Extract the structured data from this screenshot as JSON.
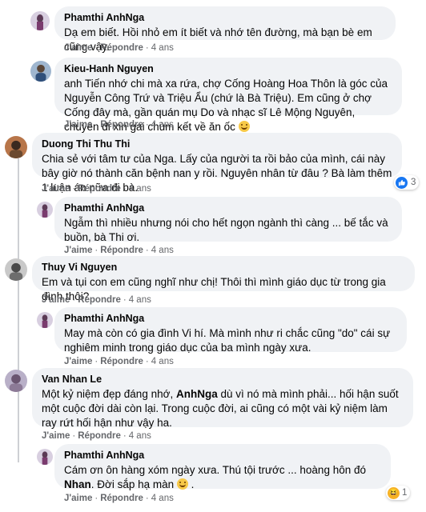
{
  "actions": {
    "like": "J'aime",
    "reply": "Répondre",
    "separator": "·"
  },
  "comments": [
    {
      "author": "Phamthi AnhNga",
      "text_parts": [
        {
          "t": "Dạ em biết. Hồi nhỏ em ít biết và nhớ tên đường, mà bạn bè em cũng vậy.",
          "b": false
        }
      ],
      "time": "4 ans"
    },
    {
      "author": "Kieu-Hanh Nguyen",
      "text_parts": [
        {
          "t": "anh Tiến nhớ chi mà xa rứa, chợ Cống Hoàng Hoa Thôn là góc của Nguyễn Công Trứ và Triệu Ẩu (chứ là Bà Triệu). Em cũng ở chợ Cống đây mà, gần quán mụ Do và nhạc sĩ Lê Mộng Nguyên, chuyên đi xin gai chùm kết về ăn ốc",
          "b": false
        }
      ],
      "time": "4 ans",
      "emoji": "grin-emoji"
    },
    {
      "author": "Duong Thi Thu Thi",
      "text_parts": [
        {
          "t": "Chia sẻ với tâm tư của Nga. Lấy của người ta rồi bảo của mình, cái này bây giờ nó thành căn bệnh nan y rồi. Nguyên nhân từ đâu ? Bà làm thêm 1 luận án nữa đi bà.",
          "b": false
        }
      ],
      "time": "4 ans",
      "reaction_count": "3"
    },
    {
      "author": "Phamthi AnhNga",
      "text_parts": [
        {
          "t": "Ngẫm thì nhiều nhưng nói cho hết ngọn ngành thì càng ... bế tắc và buồn, bà Thi ơi.",
          "b": false
        }
      ],
      "time": "4 ans"
    },
    {
      "author": "Thuy Vi Nguyen",
      "text_parts": [
        {
          "t": "Em và tụi con em cũng nghĩ như chị! Thôi thì mình giáo dục từ trong gia đình thôi?",
          "b": false
        }
      ],
      "time": "4 ans"
    },
    {
      "author": "Phamthi AnhNga",
      "text_parts": [
        {
          "t": "May mà còn có gia đình Vi hí. Mà mình như ri chắc cũng \"do\" cái sự nghiêm minh trong giáo dục của ba mình ngày xưa.",
          "b": false
        }
      ],
      "time": "4 ans"
    },
    {
      "author": "Van Nhan Le",
      "text_parts": [
        {
          "t": "Một kỷ niệm đẹp đáng nhớ, ",
          "b": false
        },
        {
          "t": "AnhNga",
          "b": true
        },
        {
          "t": " dù vì nó mà mình phải... hối hận suốt một cuộc đời dài còn lại. Trong cuộc đời, ai cũng có một vài kỷ niệm làm ray rứt hối hận như vậy ha.",
          "b": false
        }
      ],
      "time": "4 ans"
    },
    {
      "author": "Phamthi AnhNga",
      "text_parts": [
        {
          "t": "Cám ơn ôn hàng xóm ngày xưa. Thú tội trước ... hoàng hôn đó ",
          "b": false
        },
        {
          "t": "Nhan",
          "b": true
        },
        {
          "t": ". Đời sắp hạ màn",
          "b": false
        }
      ],
      "time": "4 ans",
      "emoji": "smile-emoji",
      "trailing": " .",
      "reaction_count": "1"
    }
  ]
}
